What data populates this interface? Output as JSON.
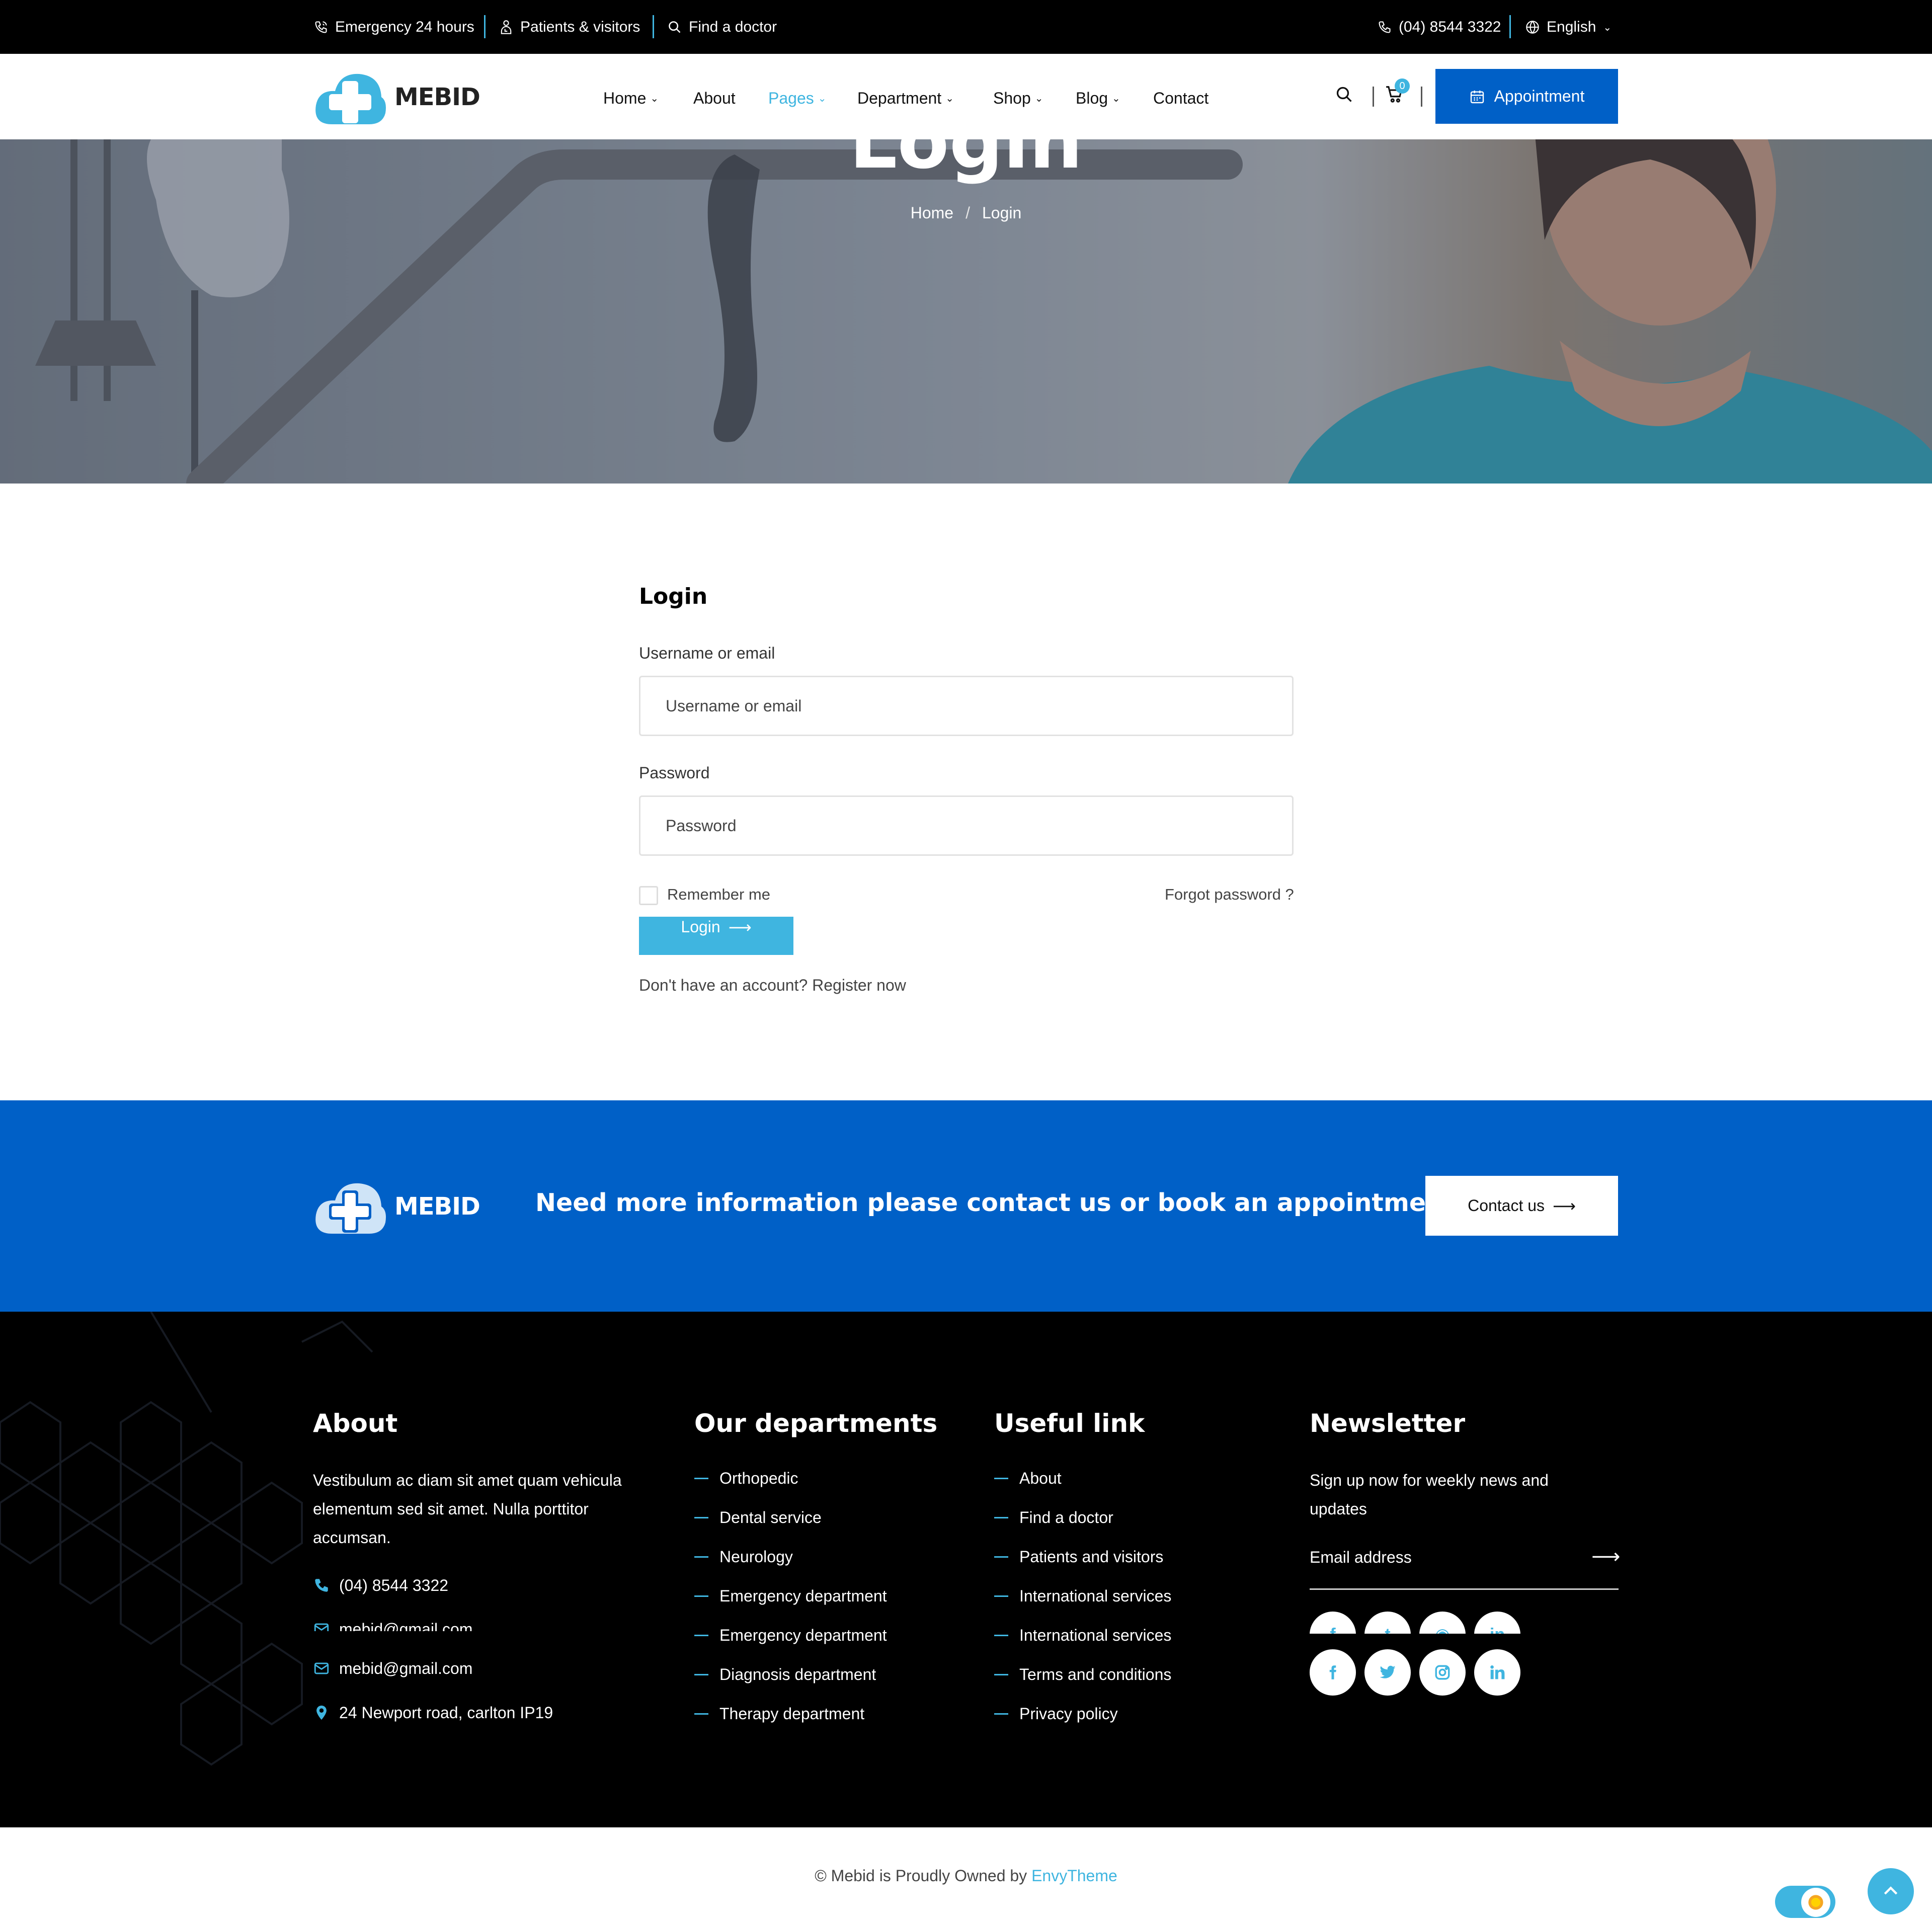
{
  "topbar": {
    "emergency": "Emergency 24 hours",
    "patients": "Patients & visitors",
    "find_doctor": "Find a doctor",
    "phone": "(04) 8544 3322",
    "language": "English"
  },
  "nav": {
    "logo_text": "MEBID",
    "items": [
      {
        "label": "Home",
        "has_dropdown": true
      },
      {
        "label": "About",
        "has_dropdown": false
      },
      {
        "label": "Pages",
        "has_dropdown": true,
        "active": true
      },
      {
        "label": "Department",
        "has_dropdown": true
      },
      {
        "label": "Shop",
        "has_dropdown": true
      },
      {
        "label": "Blog",
        "has_dropdown": true
      },
      {
        "label": "Contact",
        "has_dropdown": false
      }
    ],
    "cart_count": "0",
    "appointment_label": "Appointment"
  },
  "hero": {
    "title": "Login",
    "breadcrumb_home": "Home",
    "breadcrumb_sep": "/",
    "breadcrumb_current": "Login"
  },
  "login_form": {
    "heading": "Login",
    "username_label": "Username or email",
    "username_placeholder": "Username or email",
    "password_label": "Password",
    "password_placeholder": "Password",
    "remember_label": "Remember me",
    "remember_checked": false,
    "forgot_label": "Forgot password ?",
    "submit_label": "Login",
    "register_text": "Don't have an account? Register now"
  },
  "cta": {
    "logo_text": "MEBID",
    "text": "Need more information please contact us or book an appointment",
    "button_label": "Contact us"
  },
  "footer": {
    "about": {
      "heading": "About",
      "text": "Vestibulum ac diam sit amet quam vehicula elementum sed sit amet. Nulla porttitor accumsan.",
      "phone": "(04) 8544 3322",
      "email_1": "mebid@gmail.com",
      "email_2": "mebid@gmail.com",
      "address": "24 Newport road, carlton IP19"
    },
    "departments": {
      "heading": "Our departments",
      "items": [
        "Orthopedic",
        "Dental service",
        "Neurology",
        "Emergency department",
        "Emergency department",
        "Diagnosis department",
        "Therapy department"
      ]
    },
    "useful": {
      "heading": "Useful link",
      "items": [
        "About",
        "Find a doctor",
        "Patients and visitors",
        "International services",
        "International services",
        "Terms and conditions",
        "Privacy policy"
      ]
    },
    "newsletter": {
      "heading": "Newsletter",
      "text": "Sign up now for weekly news and updates",
      "email_placeholder": "Email address"
    },
    "social_icons": [
      "facebook-icon",
      "twitter-icon",
      "instagram-icon",
      "linkedin-icon"
    ]
  },
  "bottom": {
    "copyright_prefix": "© Mebid is Proudly Owned by ",
    "brand": "EnvyTheme"
  },
  "colors": {
    "accent": "#3fb5e0",
    "primary": "#0060c7",
    "topbar_bg": "#000000",
    "footer_bg": "#000000"
  }
}
